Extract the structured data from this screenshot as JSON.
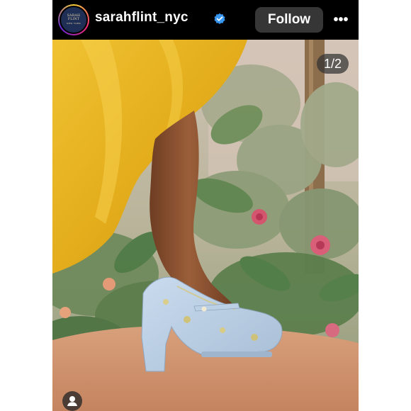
{
  "header": {
    "avatar_text_line1": "SARAH FLINT",
    "avatar_text_line2": "NEW YORK",
    "username": "sarahflint_nyc",
    "verified_icon": "verified-badge-icon",
    "follow_label": "Follow",
    "more_icon": "more-options-icon",
    "more_glyph": "•••"
  },
  "post": {
    "counter": "1/2",
    "tag_icon": "user-tag-icon"
  },
  "colors": {
    "background": "#000000",
    "follow_button": "#363636",
    "verified": "#3897f0",
    "dress": "#e7b421",
    "shoe": "#b9cde2"
  }
}
